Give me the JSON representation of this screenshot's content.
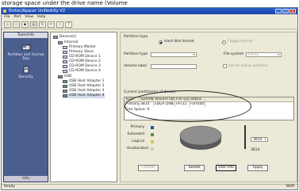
{
  "caption": "storage space under the drive name (Volume",
  "window": {
    "title": "Emtec/Apacer UnifiedUty V2"
  },
  "menu": [
    "File",
    "Part",
    "View",
    "Help"
  ],
  "toolbar_icons": [
    "new-icon",
    "open-icon",
    "save-icon",
    "print-icon",
    "refresh-icon",
    "cut-icon",
    "info-icon",
    "help-icon"
  ],
  "left_pane": {
    "title": "Tools/Info",
    "items": [
      {
        "label": "Partition and Format Tool",
        "icon": "disk-tool-icon"
      },
      {
        "label": "Security",
        "icon": "security-icon"
      }
    ],
    "bottom": "Info"
  },
  "tree": {
    "root": "Device(s)",
    "internal": "Internal",
    "internal_items": [
      "Primary Master",
      "Primary Slave",
      "CD-ROM Device 1",
      "CD-ROM Device 2",
      "CD-ROM Device 3",
      "CD-ROM Device 4"
    ],
    "usb": "USB",
    "usb_items": [
      "USB Host Adapter 1",
      "USB Host Adapter 2",
      "USB Host Adapter 3",
      "USB Host Adapter 4"
    ]
  },
  "panel": {
    "partition_type_label": "Partition type",
    "mode_primary": "Hard disk format",
    "mode_other": "Floppy format",
    "partition_type_field": "Partition type",
    "file_system_label": "File system",
    "file_system_value": "FAT32",
    "volume_label": "Volume label",
    "option_dim": "Set as active partition",
    "grid_caption": "Current partition(s) of device",
    "grid_headers": [
      "Type",
      "Size(MB)",
      "Volume label",
      "File sys",
      "Status"
    ],
    "grid_rows": [
      [
        "Primary",
        "3814",
        "EBGA DINE",
        "FAT32",
        "Formatted"
      ]
    ],
    "free_space": "Free Space: 0",
    "legend": [
      "Primary",
      "Extended",
      "Logical",
      "Unallocated"
    ],
    "spin_value": "3814",
    "total_label": "3814",
    "buttons": [
      "Format",
      "Delete",
      "Disk Info",
      "Apply"
    ]
  },
  "status": {
    "left": "Ready",
    "right": "NUM"
  },
  "colors": {
    "pie_top": "#8f8f8f",
    "pie_side": "#5a5a5a",
    "selection": "#d3dbec"
  }
}
